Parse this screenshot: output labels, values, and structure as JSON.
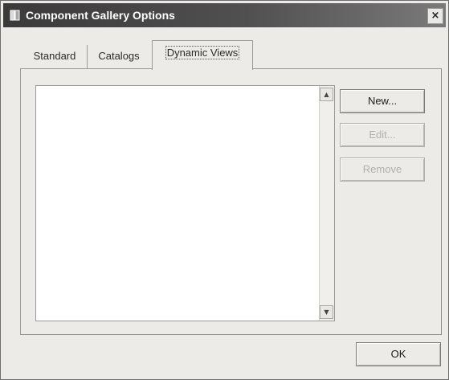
{
  "window": {
    "title": "Component Gallery Options",
    "close_glyph": "×"
  },
  "tabs": [
    {
      "label": "Standard",
      "active": false
    },
    {
      "label": "Catalogs",
      "active": false
    },
    {
      "label": "Dynamic Views",
      "active": true
    }
  ],
  "list": {
    "items": [],
    "scroll_up_glyph": "▲",
    "scroll_down_glyph": "▼"
  },
  "buttons": {
    "new_label": "New...",
    "edit_label": "Edit...",
    "remove_label": "Remove",
    "ok_label": "OK"
  },
  "icons": {
    "title": "app-icon",
    "close": "close-icon"
  }
}
